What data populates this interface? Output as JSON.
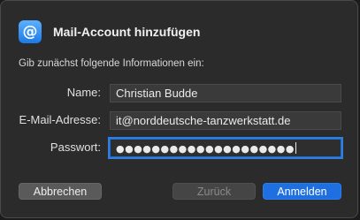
{
  "dialog": {
    "title": "Mail-Account hinzufügen",
    "app_icon_glyph": "@",
    "instructions": "Gib zunächst folgende Informationen ein:"
  },
  "form": {
    "name_label": "Name:",
    "name_value": "Christian Budde",
    "email_label": "E-Mail-Adresse:",
    "email_value": "it@norddeutsche-tanzwerkstatt.de",
    "password_label": "Passwort:",
    "password_value": "●●●●●●●●●●●●●●●●●●●●"
  },
  "buttons": {
    "cancel_label": "Abbrechen",
    "back_label": "Zurück",
    "login_label": "Anmelden"
  },
  "colors": {
    "accent": "#1e6fe0",
    "background": "#2b2b2b",
    "field": "#3a3a3a"
  }
}
